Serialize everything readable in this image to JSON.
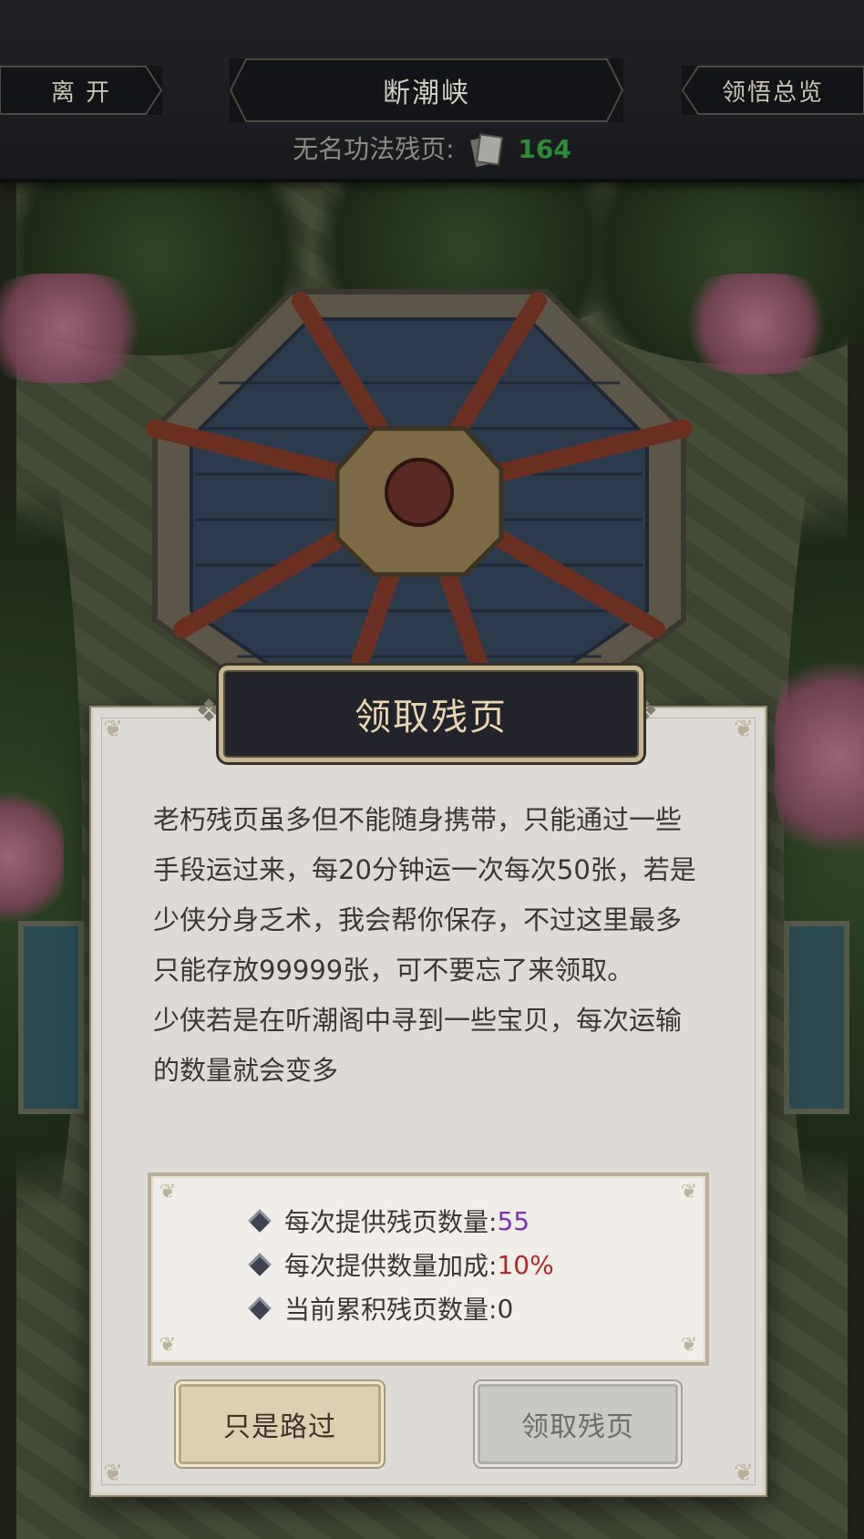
{
  "header": {
    "leave_label": "离 开",
    "location_title": "断潮峡",
    "overview_label": "领悟总览",
    "pages_label": "无名功法残页:",
    "pages_count": "164"
  },
  "dialog": {
    "title": "领取残页",
    "paragraphs": [
      "老朽残页虽多但不能随身携带，只能通过一些手段运过来，每20分钟运一次每次50张，若是少侠分身乏术，我会帮你保存，不过这里最多只能存放99999张，可不要忘了来领取。",
      "少侠若是在听潮阁中寻到一些宝贝，每次运输的数量就会变多"
    ],
    "stats": [
      {
        "label": "每次提供残页数量:",
        "value": "55"
      },
      {
        "label": "每次提供数量加成:",
        "value": "10%"
      },
      {
        "label": "当前累积残页数量:",
        "value": "0"
      }
    ],
    "colors": {
      "purple": "#7a2fb8",
      "red": "#b02a2a"
    },
    "pass_button": "只是路过",
    "claim_button": "领取残页"
  }
}
